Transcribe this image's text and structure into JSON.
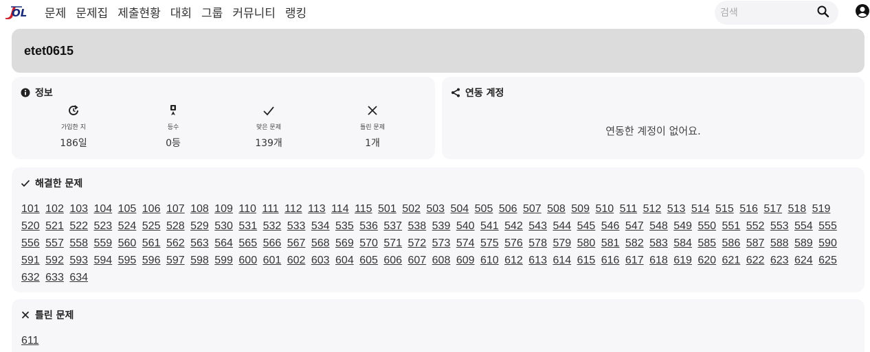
{
  "nav": {
    "menu": [
      "문제",
      "문제집",
      "제출현황",
      "대회",
      "그룹",
      "커뮤니티",
      "랭킹"
    ],
    "search_placeholder": "검색"
  },
  "profile": {
    "username": "etet0615"
  },
  "info": {
    "title": "정보",
    "stats": [
      {
        "icon": "history-icon",
        "label": "가입한 지",
        "value": "186일"
      },
      {
        "icon": "medal-icon",
        "label": "등수",
        "value": "0등"
      },
      {
        "icon": "check-icon",
        "label": "맞은 문제",
        "value": "139개"
      },
      {
        "icon": "x-icon",
        "label": "틀린 문제",
        "value": "1개"
      }
    ]
  },
  "linked": {
    "title": "연동 계정",
    "empty_text": "연동한 계정이 없어요."
  },
  "solved": {
    "title": "해결한 문제",
    "problems": [
      "101",
      "102",
      "103",
      "104",
      "105",
      "106",
      "107",
      "108",
      "109",
      "110",
      "111",
      "112",
      "113",
      "114",
      "115",
      "501",
      "502",
      "503",
      "504",
      "505",
      "506",
      "507",
      "508",
      "509",
      "510",
      "511",
      "512",
      "513",
      "514",
      "515",
      "516",
      "517",
      "518",
      "519",
      "520",
      "521",
      "522",
      "523",
      "524",
      "525",
      "528",
      "529",
      "530",
      "531",
      "532",
      "533",
      "534",
      "535",
      "536",
      "537",
      "538",
      "539",
      "540",
      "541",
      "542",
      "543",
      "544",
      "545",
      "546",
      "547",
      "548",
      "549",
      "550",
      "551",
      "552",
      "553",
      "554",
      "555",
      "556",
      "557",
      "558",
      "559",
      "560",
      "561",
      "562",
      "563",
      "564",
      "565",
      "566",
      "567",
      "568",
      "569",
      "570",
      "571",
      "572",
      "573",
      "574",
      "575",
      "576",
      "578",
      "579",
      "580",
      "581",
      "582",
      "583",
      "584",
      "585",
      "586",
      "587",
      "588",
      "589",
      "590",
      "591",
      "592",
      "593",
      "594",
      "595",
      "596",
      "597",
      "598",
      "599",
      "600",
      "601",
      "602",
      "603",
      "604",
      "605",
      "606",
      "607",
      "608",
      "609",
      "610",
      "612",
      "613",
      "614",
      "615",
      "616",
      "617",
      "618",
      "619",
      "620",
      "621",
      "622",
      "623",
      "624",
      "625",
      "632",
      "633",
      "634"
    ]
  },
  "wrong": {
    "title": "틀린 문제",
    "problems": [
      "611"
    ]
  },
  "colors": {
    "logo_blue": "#1a2a7a",
    "logo_red": "#d0202a",
    "header_bg": "#dcdcdc",
    "card_bg": "#f7f7f9"
  }
}
